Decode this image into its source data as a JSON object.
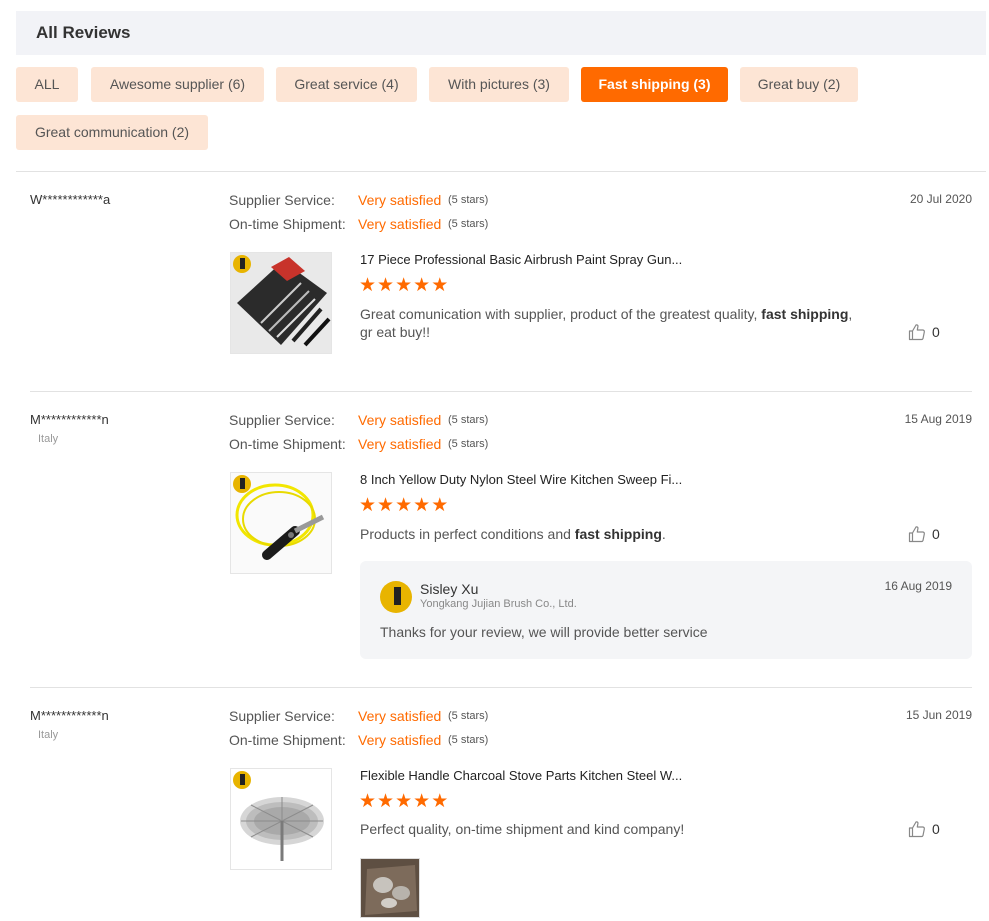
{
  "header": {
    "title": "All Reviews"
  },
  "filters": [
    {
      "label": "ALL",
      "active": false
    },
    {
      "label": "Awesome supplier (6)",
      "active": false
    },
    {
      "label": "Great service (4)",
      "active": false
    },
    {
      "label": "With pictures (3)",
      "active": false
    },
    {
      "label": "Fast shipping (3)",
      "active": true
    },
    {
      "label": "Great buy (2)",
      "active": false
    },
    {
      "label": "Great communication (2)",
      "active": false
    }
  ],
  "reviews": [
    {
      "buyer": "W************a",
      "country": "",
      "supplier_label": "Supplier Service:",
      "supplier_value": "Very satisfied",
      "supplier_stars": "(5 stars)",
      "shipment_label": "On-time Shipment:",
      "shipment_value": "Very satisfied",
      "shipment_stars": "(5 stars)",
      "date": "20 Jul 2020",
      "product_title": "17 Piece Professional Basic Airbrush Paint Spray Gun...",
      "rating": 5,
      "text_before": "Great comunication with supplier, product of the greatest quality, ",
      "text_highlight": "fast shipping",
      "text_after": ", gr eat buy!!",
      "likes": "0"
    },
    {
      "buyer": "M************n",
      "country": "Italy",
      "supplier_label": "Supplier Service:",
      "supplier_value": "Very satisfied",
      "supplier_stars": "(5 stars)",
      "shipment_label": "On-time Shipment:",
      "shipment_value": "Very satisfied",
      "shipment_stars": "(5 stars)",
      "date": "15 Aug 2019",
      "product_title": "8 Inch Yellow Duty Nylon Steel Wire Kitchen Sweep Fi...",
      "rating": 5,
      "text_before": "Products in perfect conditions and ",
      "text_highlight": "fast shipping",
      "text_after": ".",
      "likes": "0",
      "reply": {
        "name": "Sisley Xu",
        "company": "Yongkang Jujian Brush Co., Ltd.",
        "date": "16 Aug 2019",
        "text": "Thanks for your review,  we will provide better service"
      }
    },
    {
      "buyer": "M************n",
      "country": "Italy",
      "supplier_label": "Supplier Service:",
      "supplier_value": "Very satisfied",
      "supplier_stars": "(5 stars)",
      "shipment_label": "On-time Shipment:",
      "shipment_value": "Very satisfied",
      "shipment_stars": "(5 stars)",
      "date": "15 Jun 2019",
      "product_title": "Flexible Handle Charcoal Stove Parts Kitchen Steel W...",
      "rating": 5,
      "text_before": "Perfect quality, on-time shipment and kind company!",
      "text_highlight": "",
      "text_after": "",
      "likes": "0"
    }
  ],
  "icons": {
    "star": "star-icon",
    "like": "thumbs-up-icon"
  },
  "colors": {
    "accent": "#ff6a00",
    "chip_bg": "#fde5d5",
    "header_bg": "#f2f3f7"
  }
}
